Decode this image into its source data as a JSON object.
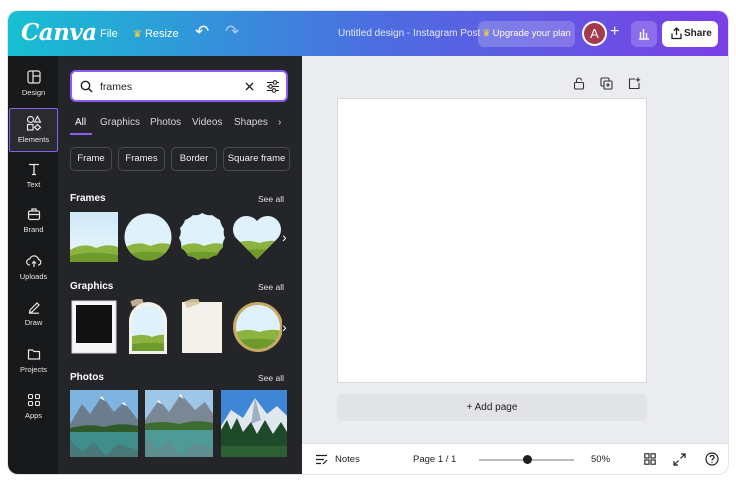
{
  "app": {
    "logo": "Canva",
    "menu_file": "File",
    "menu_resize": "Resize",
    "doc_title": "Untitled design - Instagram Post",
    "upgrade_label": "Upgrade your plan",
    "avatar_initial": "A",
    "share_label": "Share",
    "accent_color": "#8b5cf6"
  },
  "rail": {
    "items": [
      {
        "label": "Design",
        "icon": "layout-icon"
      },
      {
        "label": "Elements",
        "icon": "shapes-icon"
      },
      {
        "label": "Text",
        "icon": "text-icon"
      },
      {
        "label": "Brand",
        "icon": "briefcase-icon"
      },
      {
        "label": "Uploads",
        "icon": "cloud-upload-icon"
      },
      {
        "label": "Draw",
        "icon": "pen-icon"
      },
      {
        "label": "Projects",
        "icon": "folder-icon"
      },
      {
        "label": "Apps",
        "icon": "apps-grid-icon"
      }
    ]
  },
  "panel": {
    "search_value": "frames",
    "tabs": [
      "All",
      "Graphics",
      "Photos",
      "Videos",
      "Shapes"
    ],
    "chips": [
      "Frame",
      "Frames",
      "Border",
      "Square frame"
    ],
    "sections": {
      "frames": {
        "title": "Frames",
        "see_all": "See all"
      },
      "graphics": {
        "title": "Graphics",
        "see_all": "See all"
      },
      "photos": {
        "title": "Photos",
        "see_all": "See all"
      }
    }
  },
  "canvas": {
    "add_page": "+ Add page"
  },
  "bottombar": {
    "notes": "Notes",
    "page_indicator": "Page 1 / 1",
    "zoom": "50%",
    "zoom_fraction": 0.5
  }
}
